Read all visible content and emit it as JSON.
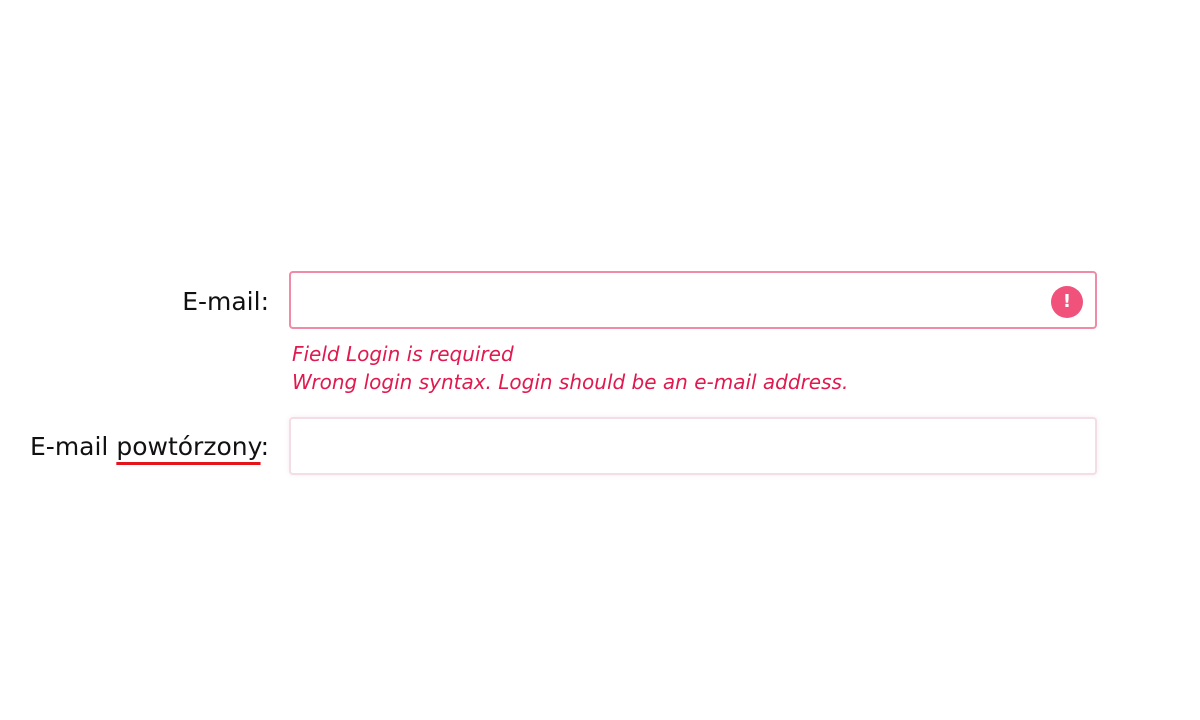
{
  "form": {
    "email": {
      "label": "E-mail:",
      "value": "",
      "placeholder": "",
      "error_icon": "exclamation-icon",
      "error_icon_glyph": "!",
      "errors": [
        "Field Login is required",
        "Wrong login syntax. Login should be an e-mail address."
      ]
    },
    "email_repeat": {
      "label_plain": "E-mail ",
      "label_misspelled": "powtórzony",
      "label_colon": ":",
      "value": "",
      "placeholder": ""
    }
  },
  "colors": {
    "error_text": "#e0194f",
    "error_border": "#f08aa6",
    "error_icon_bg": "#f0527c",
    "spellcheck_underline": "#e3141b"
  }
}
